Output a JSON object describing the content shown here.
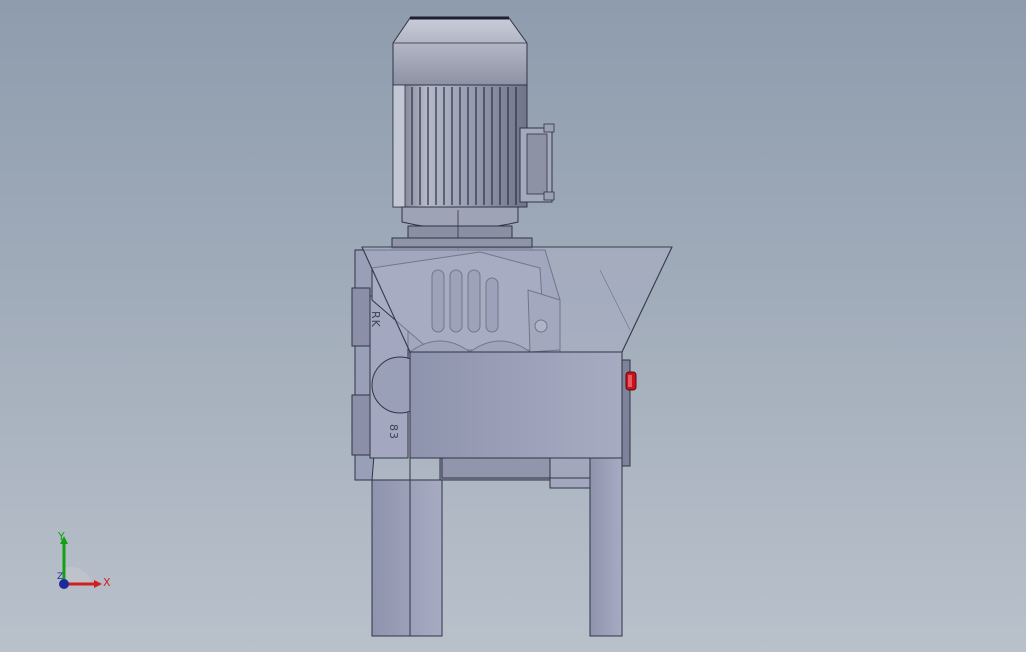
{
  "viewport": {
    "background_top": "#8e9cad",
    "background_bottom": "#b9c1cb"
  },
  "model": {
    "parts": [
      "motor-fan-cover",
      "motor-cooling-fins",
      "terminal-box",
      "gearbox-housing",
      "feed-hopper",
      "cutting-chamber",
      "shaft-end-cap",
      "support-frame",
      "stop-button"
    ],
    "housing_markings": {
      "brand": "RK",
      "size": "83"
    },
    "stop_button_color": "#c8141e"
  },
  "triad": {
    "x_label": "X",
    "y_label": "Y",
    "z_label": "Z",
    "x_color": "#d21e1e",
    "y_color": "#14a014",
    "z_color": "#1e2a9c"
  }
}
